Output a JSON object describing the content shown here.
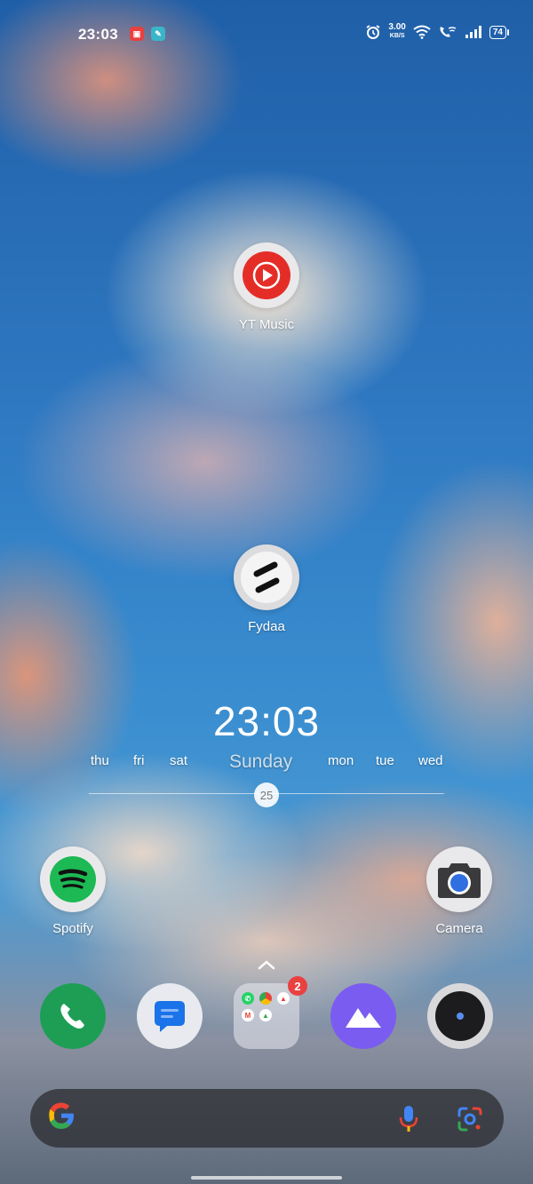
{
  "status_bar": {
    "time": "23:03",
    "net_speed_value": "3.00",
    "net_speed_unit": "KB/S",
    "battery": "74"
  },
  "apps": {
    "yt_music": "YT Music",
    "fydaa": "Fydaa",
    "spotify": "Spotify",
    "camera": "Camera"
  },
  "clock_widget": {
    "time": "23:03",
    "days": [
      "thu",
      "fri",
      "sat",
      "Sunday",
      "mon",
      "tue",
      "wed"
    ],
    "date": "25"
  },
  "dock": {
    "folder_badge": "2"
  },
  "colors": {
    "spotify": "#1DB954",
    "yt_red": "#e52d27",
    "phone_green": "#1e9e55",
    "messages_blue": "#1a73e8",
    "gallery_purple": "#7b5cf0"
  }
}
